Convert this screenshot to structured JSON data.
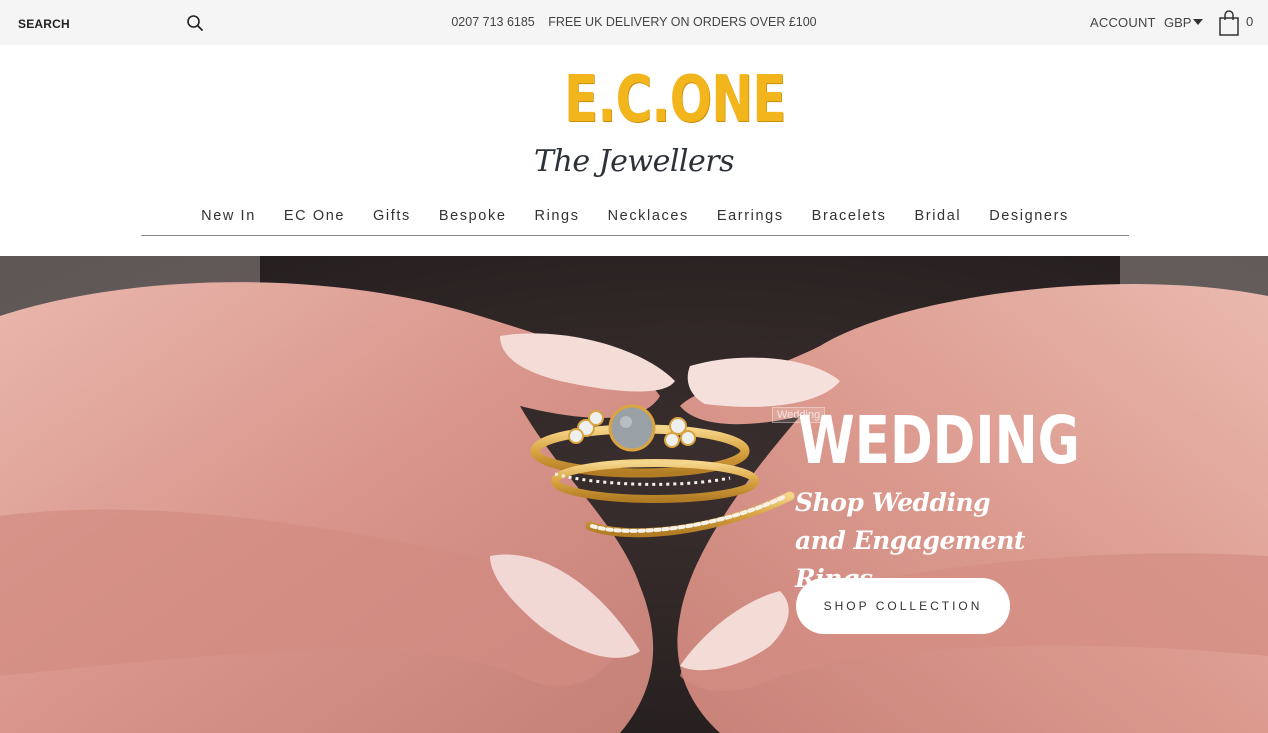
{
  "topbar": {
    "search_label": "SEARCH",
    "phone": "0207 713 6185",
    "delivery": "FREE UK DELIVERY ON ORDERS OVER £100",
    "account": "ACCOUNT",
    "currency": "GBP",
    "cart_count": "0"
  },
  "logo": {
    "main": "E.C.ONE",
    "sub": "The Jewellers",
    "colors": {
      "gold": "#f2b51c",
      "dark": "#2d3238"
    }
  },
  "nav": {
    "items": [
      "New In",
      "EC One",
      "Gifts",
      "Bespoke",
      "Rings",
      "Necklaces",
      "Earrings",
      "Bracelets",
      "Bridal",
      "Designers"
    ]
  },
  "hero": {
    "image_tag": "Wedding",
    "title": "WEDDING",
    "subtitle": "Shop Wedding and Engagement Rings",
    "button": "SHOP COLLECTION"
  },
  "icons": [
    "search-icon",
    "caret-down-icon",
    "shopping-bag-icon"
  ]
}
